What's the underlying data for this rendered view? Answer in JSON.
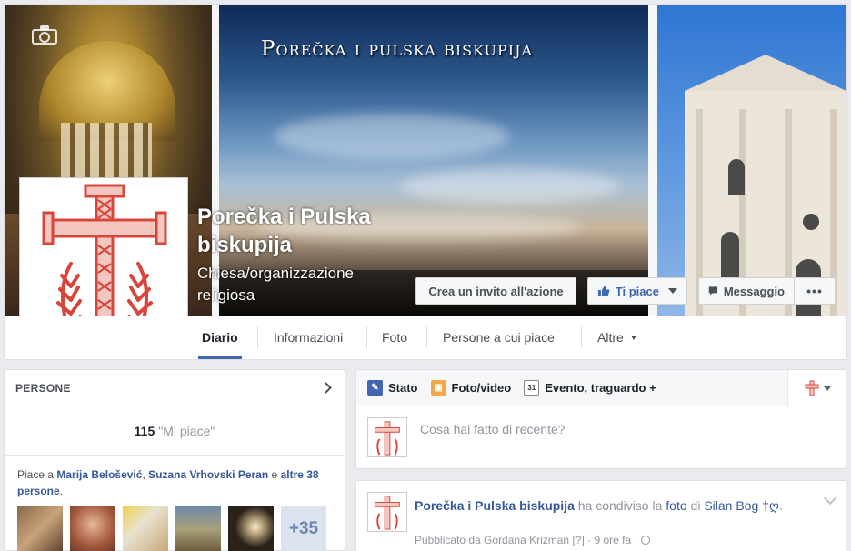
{
  "cover": {
    "title": "Porečka i pulska biskupija"
  },
  "page": {
    "name": "Porečka i Pulska biskupija",
    "category": "Chiesa/organizzazione religiosa"
  },
  "actions": {
    "cta": "Crea un invito all'azione",
    "like": "Ti piace",
    "message": "Messaggio",
    "more": "•••"
  },
  "tabs": [
    {
      "label": "Diario",
      "active": true
    },
    {
      "label": "Informazioni"
    },
    {
      "label": "Foto"
    },
    {
      "label": "Persone a cui piace"
    },
    {
      "label": "Altre"
    }
  ],
  "people": {
    "title": "PERSONE",
    "likes_count": "115",
    "likes_label": "\"Mi piace\"",
    "friends_prefix": "Piace a",
    "friend1": "Marija Belošević",
    "sep": ",",
    "friend2": "Suzana Vrhovski Peran",
    "and": "e",
    "others": "altre 38 persone",
    "period": ".",
    "more_count": "+35"
  },
  "composer": {
    "tab_status": "Stato",
    "tab_photo": "Foto/video",
    "tab_event": "Evento, traguardo +",
    "event_icon_day": "31",
    "placeholder": "Cosa hai fatto di recente?"
  },
  "post": {
    "author": "Porečka i Pulska biskupija",
    "verb": "ha condiviso la",
    "object": "foto",
    "of": "di",
    "owner": "Silan Bog †ღ",
    "period": ".",
    "published_by": "Pubblicato da Gordana Krizman",
    "qmark": "[?]",
    "dot": "·",
    "time": "9 ore fa",
    "dot2": "·"
  },
  "colors": {
    "link": "#365899",
    "accent": "#4267b2",
    "cross": "#d8453b"
  }
}
